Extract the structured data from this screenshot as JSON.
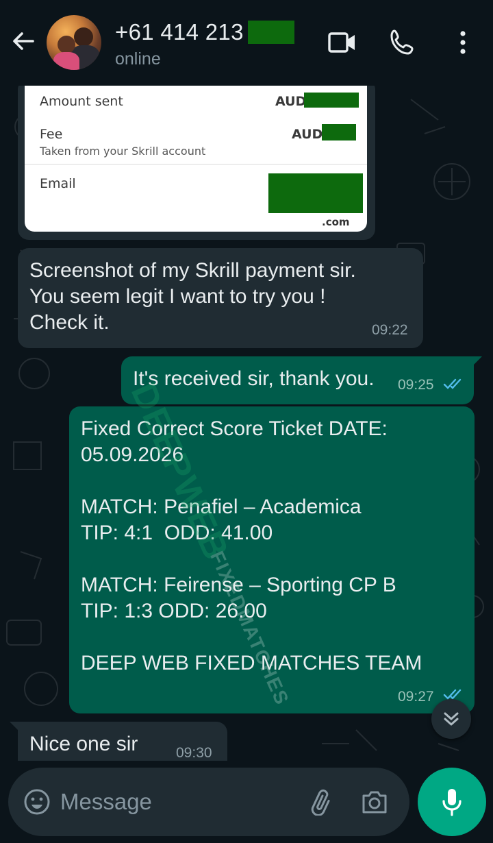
{
  "header": {
    "contact_name": "+61 414 213",
    "status": "online"
  },
  "payment_card": {
    "amount_label": "Amount sent",
    "amount_currency": "AUD",
    "fee_label": "Fee",
    "fee_sub": "Taken from your Skrill account",
    "fee_currency": "AUD",
    "email_label": "Email",
    "email_suffix": ".com"
  },
  "messages": [
    {
      "dir": "in",
      "text": "Screenshot of my Skrill payment sir.\nYou seem legit I want to try you !\nCheck it.",
      "time": "09:22"
    },
    {
      "dir": "out",
      "text": "It's received sir, thank you.",
      "time": "09:25"
    },
    {
      "dir": "out",
      "text": "Fixed Correct Score Ticket DATE:\n05.09.2026\n\nMATCH: Penafiel – Academica\nTIP: 4:1  ODD: 41.00\n\nMATCH: Feirense – Sporting CP B\nTIP: 1:3 ODD: 26.00\n\nDEEP WEB FIXED MATCHES TEAM",
      "time": "09:27"
    },
    {
      "dir": "in",
      "text": "Nice one sir",
      "time": "09:30"
    }
  ],
  "watermark": {
    "line1": "DEEPWEB",
    "line2": "FIXEDMATCHES"
  },
  "composer": {
    "placeholder": "Message"
  },
  "colors": {
    "background": "#0b141a",
    "incoming_bubble": "#202c33",
    "outgoing_bubble": "#005c4b",
    "accent": "#00a884",
    "read_ticks": "#53bdeb",
    "redaction": "#0d6a0d"
  },
  "icons": [
    "back-arrow-icon",
    "video-call-icon",
    "phone-icon",
    "more-options-icon",
    "double-check-icon",
    "chevron-double-down-icon",
    "emoji-icon",
    "paperclip-icon",
    "camera-icon",
    "microphone-icon"
  ]
}
